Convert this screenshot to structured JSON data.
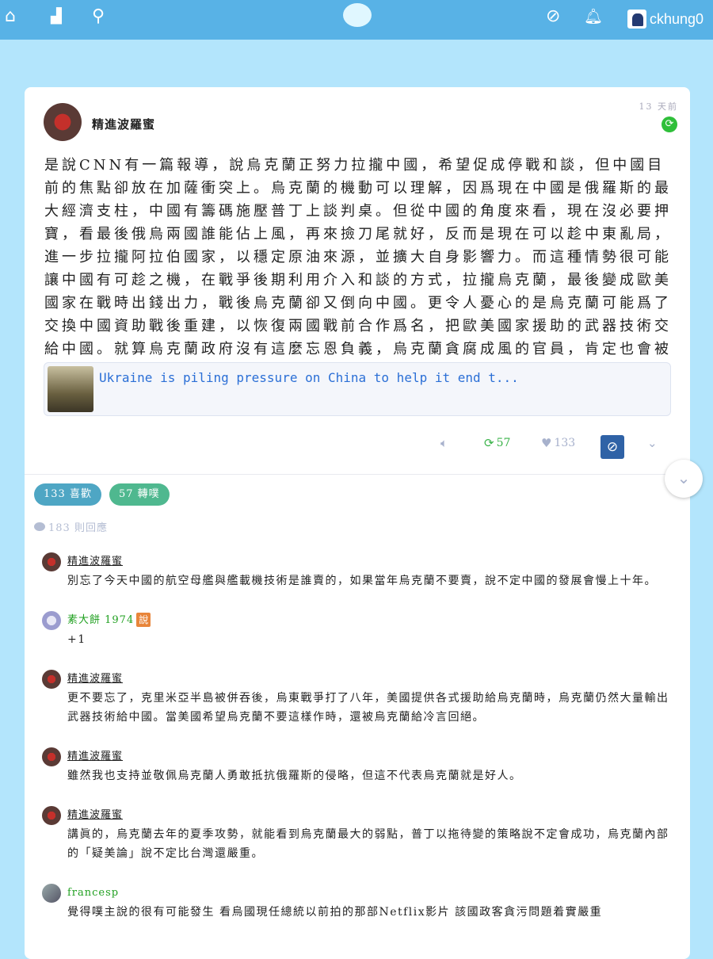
{
  "topbar": {
    "icons": [
      "home-icon",
      "ranking-icon",
      "search-icon",
      "plurk-logo",
      "compass-icon",
      "bell-icon"
    ],
    "username": "ckhung0"
  },
  "post": {
    "author": "精進波羅蜜",
    "time": "13 天前",
    "body": "是說CNN有一篇報導，說烏克蘭正努力拉攏中國，希望促成停戰和談，但中國目前的焦點卻放在加薩衝突上。烏克蘭的機動可以理解，因爲現在中國是俄羅斯的最大經濟支柱，中國有籌碼施壓普丁上談判桌。但從中國的角度來看，現在沒必要押寶，看最後俄烏兩國誰能佔上風，再來撿刀尾就好，反而是現在可以趁中東亂局，進一步拉攏阿拉伯國家，以穩定原油來源，並擴大自身影響力。而這種情勢很可能讓中國有可趁之機，在戰爭後期利用介入和談的方式，拉攏烏克蘭，最後變成歐美國家在戰時出錢出力，戰後烏克蘭卻又倒向中國。更令人憂心的是烏克蘭可能爲了交換中國資助戰後重建，以恢復兩國戰前合作爲名，把歐美國家援助的武器技術交給中國。就算烏克蘭政府沒有這麼忘恩負義，烏克蘭貪腐成風的官員，肯定也會被中國收買。",
    "link_title": "Ukraine is piling pressure on China to help it end t...",
    "replurks": "57",
    "likes": "133",
    "likes_pill": "133 喜歡",
    "replurks_pill": "57 轉噗",
    "responses": "183 則回應",
    "colors": {
      "like_pill": "#4ea6c4",
      "replurk_pill": "#4fb88f",
      "accent": "#2f62a6"
    }
  },
  "comments": [
    {
      "name": "精進波羅蜜",
      "text": "別忘了今天中國的航空母艦與艦載機技術是誰賣的，如果當年烏克蘭不要賣，說不定中國的發展會慢上十年。"
    },
    {
      "name": "素大餅 1974",
      "badge": "說",
      "text": "+1"
    },
    {
      "name": "精進波羅蜜",
      "text": "更不要忘了，克里米亞半島被併吞後，烏東戰爭打了八年，美國提供各式援助給烏克蘭時，烏克蘭仍然大量輸出武器技術給中國。當美國希望烏克蘭不要這樣作時，還被烏克蘭給冷言回絕。"
    },
    {
      "name": "精進波羅蜜",
      "text": "雖然我也支持並敬佩烏克蘭人勇敢抵抗俄羅斯的侵略，但這不代表烏克蘭就是好人。"
    },
    {
      "name": "精進波羅蜜",
      "text": "講眞的，烏克蘭去年的夏季攻勢，就能看到烏克蘭最大的弱點，普丁以拖待變的策略說不定會成功，烏克蘭內部的「疑美論」說不定比台灣還嚴重。"
    },
    {
      "name": "francesp",
      "text": "覺得噗主說的很有可能發生 看烏國現任總統以前拍的那部Netflix影片 該國政客貪污問題着實嚴重"
    }
  ]
}
